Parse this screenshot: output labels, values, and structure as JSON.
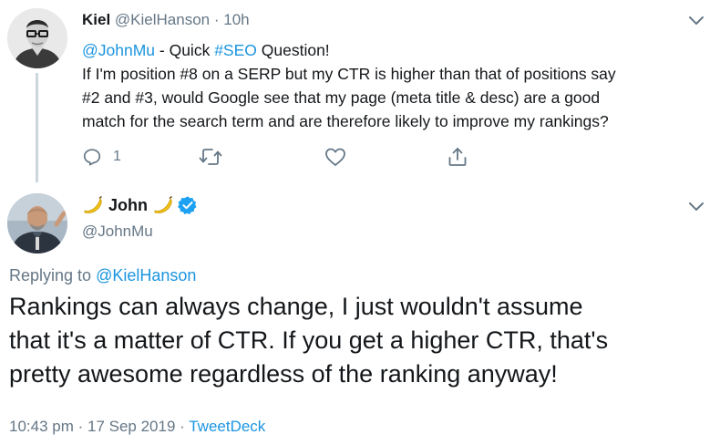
{
  "original_tweet": {
    "author_name": "Kiel",
    "author_handle": "@KielHanson",
    "separator": "·",
    "time_ago": "10h",
    "mention": "@JohnMu",
    "text_part1": " - Quick ",
    "hashtag": "#SEO",
    "text_part2": " Question!",
    "body_lines": [
      "If I'm position #8 on a SERP but my CTR is higher than that of positions say",
      "#2 and #3, would Google see that my page (meta title & desc) are a good",
      "match for the search term and are therefore likely to improve my rankings?"
    ],
    "actions": {
      "reply_count": "1",
      "retweet_count": "",
      "like_count": ""
    }
  },
  "reply_tweet": {
    "author_name": "John",
    "author_handle": "@JohnMu",
    "replying_to_label": "Replying to ",
    "replying_to_handle": "@KielHanson",
    "body_lines": [
      "Rankings can always change, I just wouldn't assume",
      "that it's a matter of CTR. If you get a higher CTR, that's",
      "pretty awesome regardless of the ranking anyway!"
    ],
    "timestamp": "10:43 pm · 17 Sep 2019 · ",
    "source": "TweetDeck"
  },
  "icons": {
    "reply": "reply-icon",
    "retweet": "retweet-icon",
    "like": "heart-icon",
    "share": "share-icon",
    "caret": "chevron-down-icon",
    "verified": "verified-badge-icon",
    "emoji": "banana-emoji"
  },
  "colors": {
    "link": "#1b95e0",
    "secondary_text": "#657786",
    "primary_text": "#14171a",
    "verified": "#1da1f2",
    "thread_line": "#ccd6dd"
  }
}
